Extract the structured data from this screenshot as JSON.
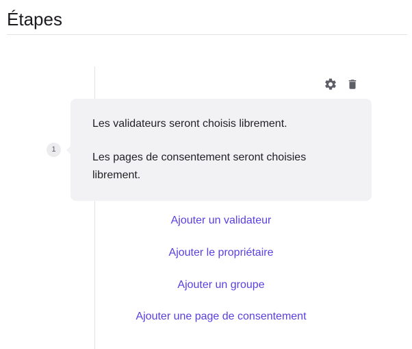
{
  "page": {
    "title": "Étapes"
  },
  "step": {
    "number": "1",
    "actions": [
      {
        "icon": "gear-icon",
        "label": "settings"
      },
      {
        "icon": "trash-icon",
        "label": "delete"
      }
    ],
    "lines": [
      "Les validateurs seront choisis librement.",
      "Les pages de consentement seront choisies librement."
    ]
  },
  "links": [
    "Ajouter un validateur",
    "Ajouter le propriétaire",
    "Ajouter un groupe",
    "Ajouter une page de consentement"
  ],
  "colors": {
    "link": "#5b3ee0",
    "card_bg": "#f2f2f4",
    "icon": "#5e5e66"
  }
}
